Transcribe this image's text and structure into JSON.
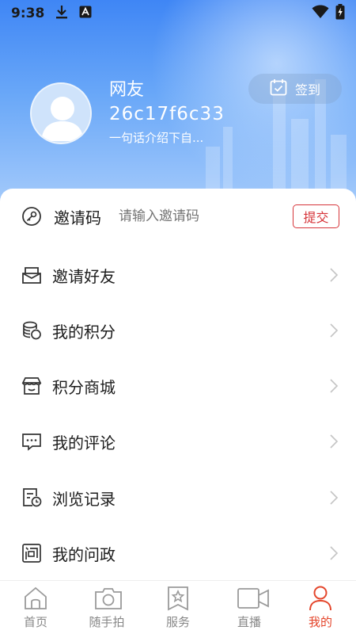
{
  "status_bar": {
    "time": "9:38",
    "icons": [
      "download-icon",
      "a-icon",
      "wifi-icon",
      "battery-charging-icon"
    ]
  },
  "profile": {
    "name": "网友",
    "user_id": "26c17f6c33",
    "bio": "一句话介绍下自...",
    "checkin_label": "签到"
  },
  "invite": {
    "label": "邀请码",
    "placeholder": "请输入邀请码",
    "submit_label": "提交",
    "icon": "key-icon"
  },
  "menu": [
    {
      "label": "邀请好友",
      "icon": "invite-friends-icon"
    },
    {
      "label": "我的积分",
      "icon": "points-coins-icon"
    },
    {
      "label": "积分商城",
      "icon": "store-icon"
    },
    {
      "label": "我的评论",
      "icon": "comment-icon"
    },
    {
      "label": "浏览记录",
      "icon": "history-icon"
    },
    {
      "label": "我的问政",
      "icon": "inquiry-icon"
    }
  ],
  "tabbar": [
    {
      "label": "首页",
      "icon": "home-icon",
      "active": false
    },
    {
      "label": "随手拍",
      "icon": "camera-icon",
      "active": false
    },
    {
      "label": "服务",
      "icon": "service-bookmark-icon",
      "active": false
    },
    {
      "label": "直播",
      "icon": "live-video-icon",
      "active": false
    },
    {
      "label": "我的",
      "icon": "user-icon",
      "active": true
    }
  ],
  "colors": {
    "accent": "#e4462c",
    "submit_border": "#d6353a",
    "header_top": "#3f86f5",
    "header_bottom": "#a9cdfb"
  }
}
